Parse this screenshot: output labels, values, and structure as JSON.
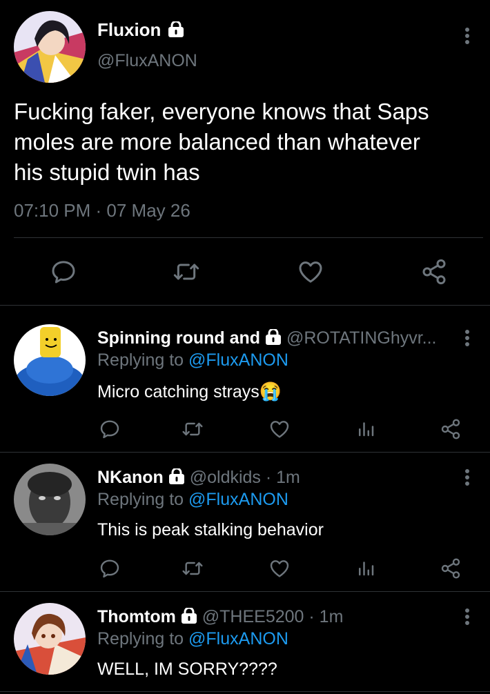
{
  "main_tweet": {
    "display_name": "Fluxion",
    "handle": "@FluxANON",
    "text_lines": [
      "Fucking faker, everyone knows that Saps",
      "moles are more balanced than whatever",
      "his stupid twin has"
    ],
    "timestamp": "07:10 PM · 07 May 26"
  },
  "replies": [
    {
      "display_name": "Spinning round and",
      "handle": "@ROTATINGhyvr...",
      "replying_label": "Replying to",
      "replying_handle": "@FluxANON",
      "text": "Micro catching strays",
      "emoji": "😭"
    },
    {
      "display_name": "NKanon",
      "handle": "@oldkids · 1m",
      "replying_label": "Replying to",
      "replying_handle": "@FluxANON",
      "text": "This is peak stalking behavior"
    },
    {
      "display_name": "Thomtom",
      "handle": "@THEE5200 · 1m",
      "replying_label": "Replying to",
      "replying_handle": "@FluxANON",
      "text": "WELL, IM SORRY????"
    }
  ],
  "icons": {
    "reply": "reply-icon",
    "retweet": "retweet-icon",
    "like": "heart-icon",
    "share": "share-icon",
    "analytics": "analytics-icon",
    "more": "more-vertical-icon",
    "lock": "lock-icon"
  },
  "colors": {
    "background": "#000000",
    "secondary_text": "#6e767d",
    "link": "#1d9bf0",
    "divider": "#2f3336"
  }
}
